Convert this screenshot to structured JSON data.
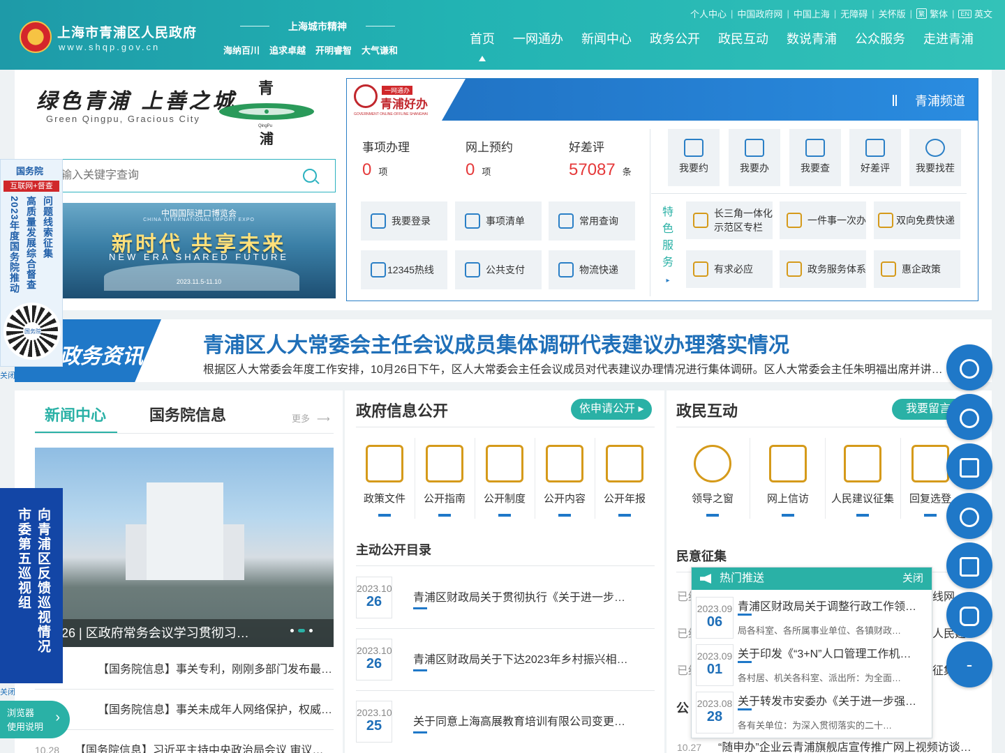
{
  "header": {
    "site_name": "上海市青浦区人民政府",
    "site_url": "www.shqp.gov.cn",
    "spirit_title": "上海城市精神",
    "spirit_words": [
      "海纳百川",
      "追求卓越",
      "开明睿智",
      "大气谦和"
    ],
    "util_links": [
      "个人中心",
      "中国政府网",
      "中国上海",
      "无障碍",
      "关怀版"
    ],
    "util_traditional": "繁体",
    "util_traditional_tag": "繁",
    "util_english": "英文",
    "util_english_tag": "EN",
    "nav": [
      "首页",
      "一网通办",
      "新闻中心",
      "政务公开",
      "政民互动",
      "数说青浦",
      "公众服务",
      "走进青浦"
    ]
  },
  "brand": {
    "slogan": "绿色青浦 上善之城",
    "slogan_en": "Green Qingpu, Gracious City",
    "logo_char_top": "青",
    "logo_char_bottom": "浦",
    "logo_en": "QingPu"
  },
  "search": {
    "placeholder": "输入关键字查询"
  },
  "banner": {
    "line1": "中国国际进口博览会",
    "line2": "CHINA INTERNATIONAL IMPORT EXPO",
    "main": "新时代 共享未来",
    "en": "NEW ERA    SHARED FUTURE",
    "date": "2023.11.5-11.10"
  },
  "haoban": {
    "logo_tag": "一网通办",
    "logo_name": "青浦好办",
    "logo_sub": "GOVERNMENT ONLINE-OFFLINE SHANGHAI",
    "channel": "青浦频道",
    "stats": [
      {
        "label": "事项办理",
        "value": "0",
        "unit": "项"
      },
      {
        "label": "网上预约",
        "value": "0",
        "unit": "项"
      },
      {
        "label": "好差评",
        "value": "57087",
        "unit": "条"
      }
    ],
    "quick": [
      "我要约",
      "我要办",
      "我要查",
      "好差评",
      "我要找茬"
    ],
    "services": [
      "我要登录",
      "事项清单",
      "常用查询",
      "12345热线",
      "公共支付",
      "物流快递"
    ],
    "special_label": "特色服务",
    "special_arrow": "▸",
    "features": [
      "长三角一体化示范区专栏",
      "一件事一次办",
      "双向免费快递",
      "有求必应",
      "政务服务体系",
      "惠企政策"
    ]
  },
  "headline": {
    "tag": "政务资讯",
    "title": "青浦区人大常委会主任会议成员集体调研代表建议办理落实情况",
    "summary": "根据区人大常委会年度工作安排，10月26日下午，区人大常委会主任会议成员对代表建议办理情况进行集体调研。区人大常委会主任朱明福出席并讲…"
  },
  "news_panel": {
    "tabs": [
      "新闻中心",
      "国务院信息"
    ],
    "more": "更多",
    "photo_caption": "26 | 区政府常务会议学习贯彻习…",
    "items": [
      {
        "date": "",
        "title": "【国务院信息】事关专利，刚刚多部门发布最新…"
      },
      {
        "date": "",
        "title": "【国务院信息】事关未成年人网络保护，权威回应"
      },
      {
        "date": "10.28",
        "title": "【国务院信息】习近平主持中央政治局会议 审议…"
      }
    ]
  },
  "gov_panel": {
    "title": "政府信息公开",
    "apply_button": "依申请公开 ▸",
    "icons": [
      "政策文件",
      "公开指南",
      "公开制度",
      "公开内容",
      "公开年报"
    ],
    "directory_title": "主动公开目录",
    "items": [
      {
        "ym": "2023.10",
        "day": "26",
        "title": "青浦区财政局关于贯彻执行《关于进一步…"
      },
      {
        "ym": "2023.10",
        "day": "26",
        "title": "青浦区财政局关于下达2023年乡村振兴相…"
      },
      {
        "ym": "2023.10",
        "day": "25",
        "title": "关于同意上海高展教育培训有限公司变更…"
      }
    ]
  },
  "interact_panel": {
    "title": "政民互动",
    "message_button": "我要留言",
    "icons": [
      "领导之窗",
      "网上信访",
      "人民建议征集",
      "回复选登"
    ],
    "opinion_title": "民意征集",
    "opinion_prefixes": [
      "已结",
      "已结",
      "已结"
    ],
    "opinion_suffixes": [
      "线网",
      "人民建",
      "征集"
    ],
    "public_title": "公",
    "bottom_item": {
      "date": "10.27",
      "title": "“随申办”企业云青浦旗舰店宣传推广网上视频访谈…"
    }
  },
  "hot_push": {
    "title": "热门推送",
    "close": "关闭",
    "items": [
      {
        "ym": "2023.09",
        "day": "06",
        "title": "青浦区财政局关于调整行政工作领…",
        "summary": "局各科室、各所属事业单位、各镇财政…"
      },
      {
        "ym": "2023.09",
        "day": "01",
        "title": "关于印发《“3+N”人口管理工作机…",
        "summary": "各村居、机关各科室、派出所：为全面…"
      },
      {
        "ym": "2023.08",
        "day": "28",
        "title": "关于转发市安委办《关于进一步强…",
        "summary": "各有关单位：为深入贯彻落实的二十…"
      }
    ]
  },
  "left_float": {
    "org": "国务院",
    "tag": "互联网+督查",
    "col1": "2023年度国务院推动",
    "col2": "高质量发展综合督查",
    "col3": "问题线索征集",
    "qr_label": "国务院",
    "close": "关闭"
  },
  "inspection": {
    "col1": "向青浦区反馈巡视情况",
    "col2": "市委第五巡视组",
    "close": "关闭"
  },
  "browser_help": {
    "line1": "浏览器",
    "line2": "使用说明",
    "chevron": "›"
  },
  "right_buttons": {
    "minus": "-"
  },
  "colors": {
    "teal": "#2ab1a6",
    "blue": "#1f78c8",
    "red": "#e5393a",
    "gold": "#d59a1a"
  }
}
